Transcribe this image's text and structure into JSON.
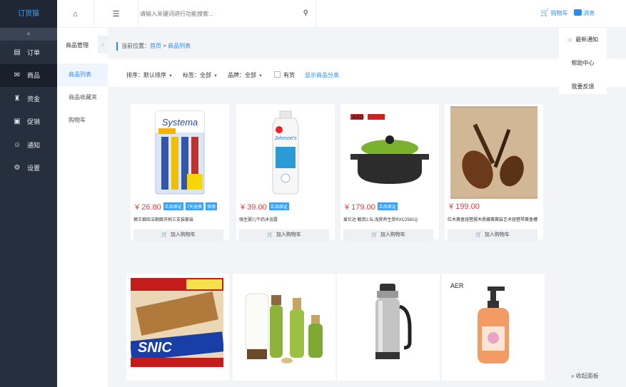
{
  "app": {
    "logo_text": "订货猫"
  },
  "sidebar": {
    "collapse_icon": "≡",
    "items": [
      {
        "icon": "order-icon",
        "glyph": "▤",
        "label": "订单"
      },
      {
        "icon": "goods-icon",
        "glyph": "✉",
        "label": "商品"
      },
      {
        "icon": "funds-icon",
        "glyph": "♜",
        "label": "资金"
      },
      {
        "icon": "promo-icon",
        "glyph": "▣",
        "label": "促销"
      },
      {
        "icon": "notice-icon",
        "glyph": "☺",
        "label": "通知"
      },
      {
        "icon": "settings-icon",
        "glyph": "⚙",
        "label": "设置"
      }
    ],
    "active_index": 1
  },
  "subnav": {
    "header": "商品管理",
    "toggle_glyph": "‹",
    "items": [
      {
        "label": "商品列表"
      },
      {
        "label": "商品收藏夹"
      },
      {
        "label": "购物车"
      }
    ],
    "active_index": 0
  },
  "topbar": {
    "home_glyph": "⌂",
    "menu_glyph": "☰",
    "search_placeholder": "请输入关键词进行功能搜索...",
    "cart_label": "购物车",
    "message_label": "消息"
  },
  "breadcrumb": {
    "prefix": "当前位置：",
    "home": "首页",
    "sep": ">",
    "current": "商品列表"
  },
  "filters": {
    "sort": "排序：默认排序",
    "tags": "标签：全部",
    "brand": "品牌：全部",
    "in_stock": "有货",
    "show_category": "显示商品分类"
  },
  "products": [
    {
      "price": "¥ 26.80",
      "tags": [
        "正品保证",
        "7天退换",
        "保修"
      ],
      "title": "狮王细齿洁朝跟牙刷三支装套装",
      "button": "加入购物车"
    },
    {
      "price": "¥ 39.00",
      "tags": [
        "正品保证"
      ],
      "title": "强生婴儿牛奶沐浴露",
      "button": "加入购物车"
    },
    {
      "price": "¥ 179.00",
      "tags": [
        "正品保证"
      ],
      "title": "爱仕达 甄用2.5L浅煲养生煲RXC2581Q",
      "button": "加入购物车"
    },
    {
      "price": "¥ 199.00",
      "tags": [],
      "title": "红木赛盒琵琶摆木质藏赛赛装艺术琵琶琴赛盒槽",
      "button": "加入购物车"
    }
  ],
  "products_row2": [
    {
      "image": "chocolate-bar-image",
      "brand_text": "SNIC"
    },
    {
      "image": "cosmetics-set-image",
      "brand_text": ""
    },
    {
      "image": "thermos-image",
      "brand_text": ""
    },
    {
      "image": "soap-dispenser-image",
      "brand_text": "AER"
    }
  ],
  "dropdown": {
    "items": [
      {
        "icon": "speaker-icon",
        "glyph": "🔈",
        "label": "最新通知"
      },
      {
        "label": "帮助中心"
      },
      {
        "label": "我要反馈"
      }
    ]
  },
  "footer": {
    "collapse_panel": "» 收起面板"
  },
  "colors": {
    "accent": "#2a8bf2",
    "sidebar": "#262f3e",
    "price": "#e4393c",
    "tag": "#3ea1ef"
  }
}
